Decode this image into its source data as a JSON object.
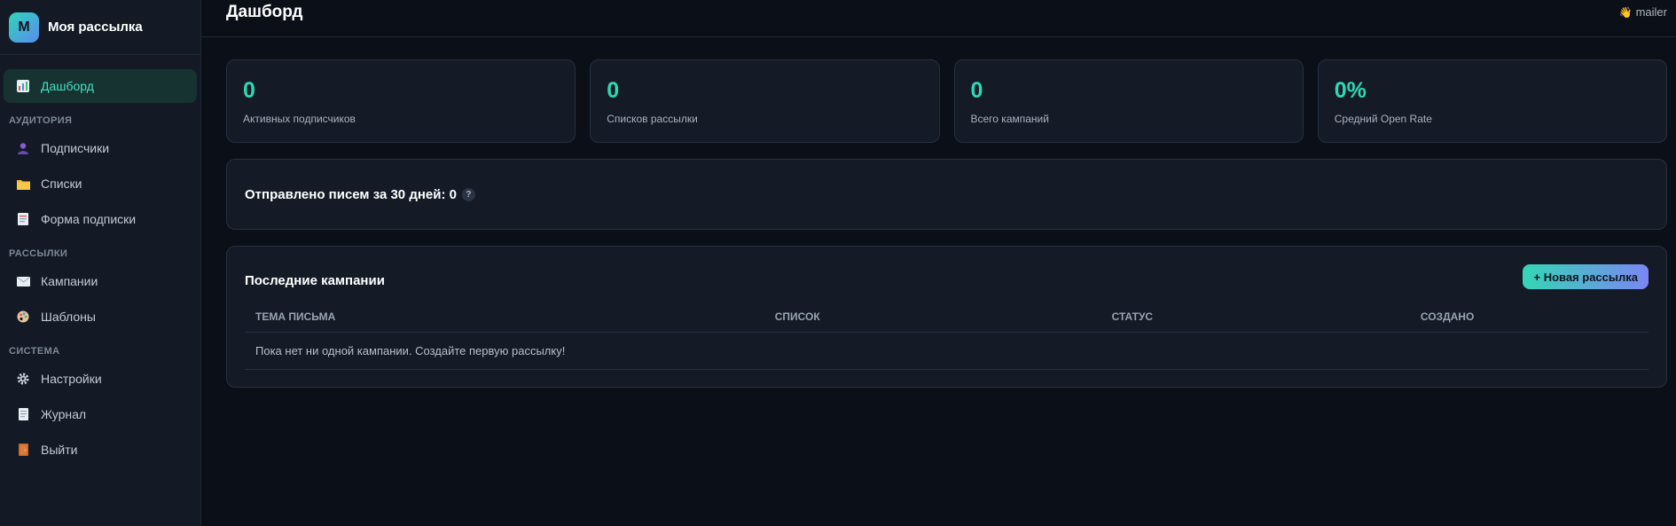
{
  "brand": {
    "logo_letter": "М",
    "name": "Моя рассылка"
  },
  "sidebar": {
    "dashboard": {
      "label": "Дашборд",
      "icon": "chart-icon"
    },
    "sections": [
      {
        "title": "Аудитория",
        "items": [
          {
            "label": "Подписчики",
            "icon": "user-icon"
          },
          {
            "label": "Списки",
            "icon": "folder-icon"
          },
          {
            "label": "Форма подписки",
            "icon": "form-icon"
          }
        ]
      },
      {
        "title": "Рассылки",
        "items": [
          {
            "label": "Кампании",
            "icon": "envelope-icon"
          },
          {
            "label": "Шаблоны",
            "icon": "palette-icon"
          }
        ]
      },
      {
        "title": "Система",
        "items": [
          {
            "label": "Настройки",
            "icon": "gear-icon"
          },
          {
            "label": "Журнал",
            "icon": "log-icon"
          },
          {
            "label": "Выйти",
            "icon": "door-icon"
          }
        ]
      }
    ]
  },
  "topbar": {
    "title": "Дашборд",
    "user": "mailer",
    "user_icon": "wave-icon"
  },
  "stats": [
    {
      "value": "0",
      "label": "Активных подписчиков"
    },
    {
      "value": "0",
      "label": "Списков рассылки"
    },
    {
      "value": "0",
      "label": "Всего кампаний"
    },
    {
      "value": "0%",
      "label": "Средний Open Rate"
    }
  ],
  "sent": {
    "text": "Отправлено писем за 30 дней: 0",
    "help": "?"
  },
  "campaigns": {
    "title": "Последние кампании",
    "new_button": "+ Новая рассылка",
    "columns": [
      "Тема письма",
      "Список",
      "Статус",
      "Создано"
    ],
    "empty_text": "Пока нет ни одной кампании. Создайте первую рассылку!"
  },
  "colors": {
    "accent": "#2fd8b4",
    "bg": "#0b0f17",
    "panel": "#141b27",
    "sidebar": "#131a25"
  }
}
